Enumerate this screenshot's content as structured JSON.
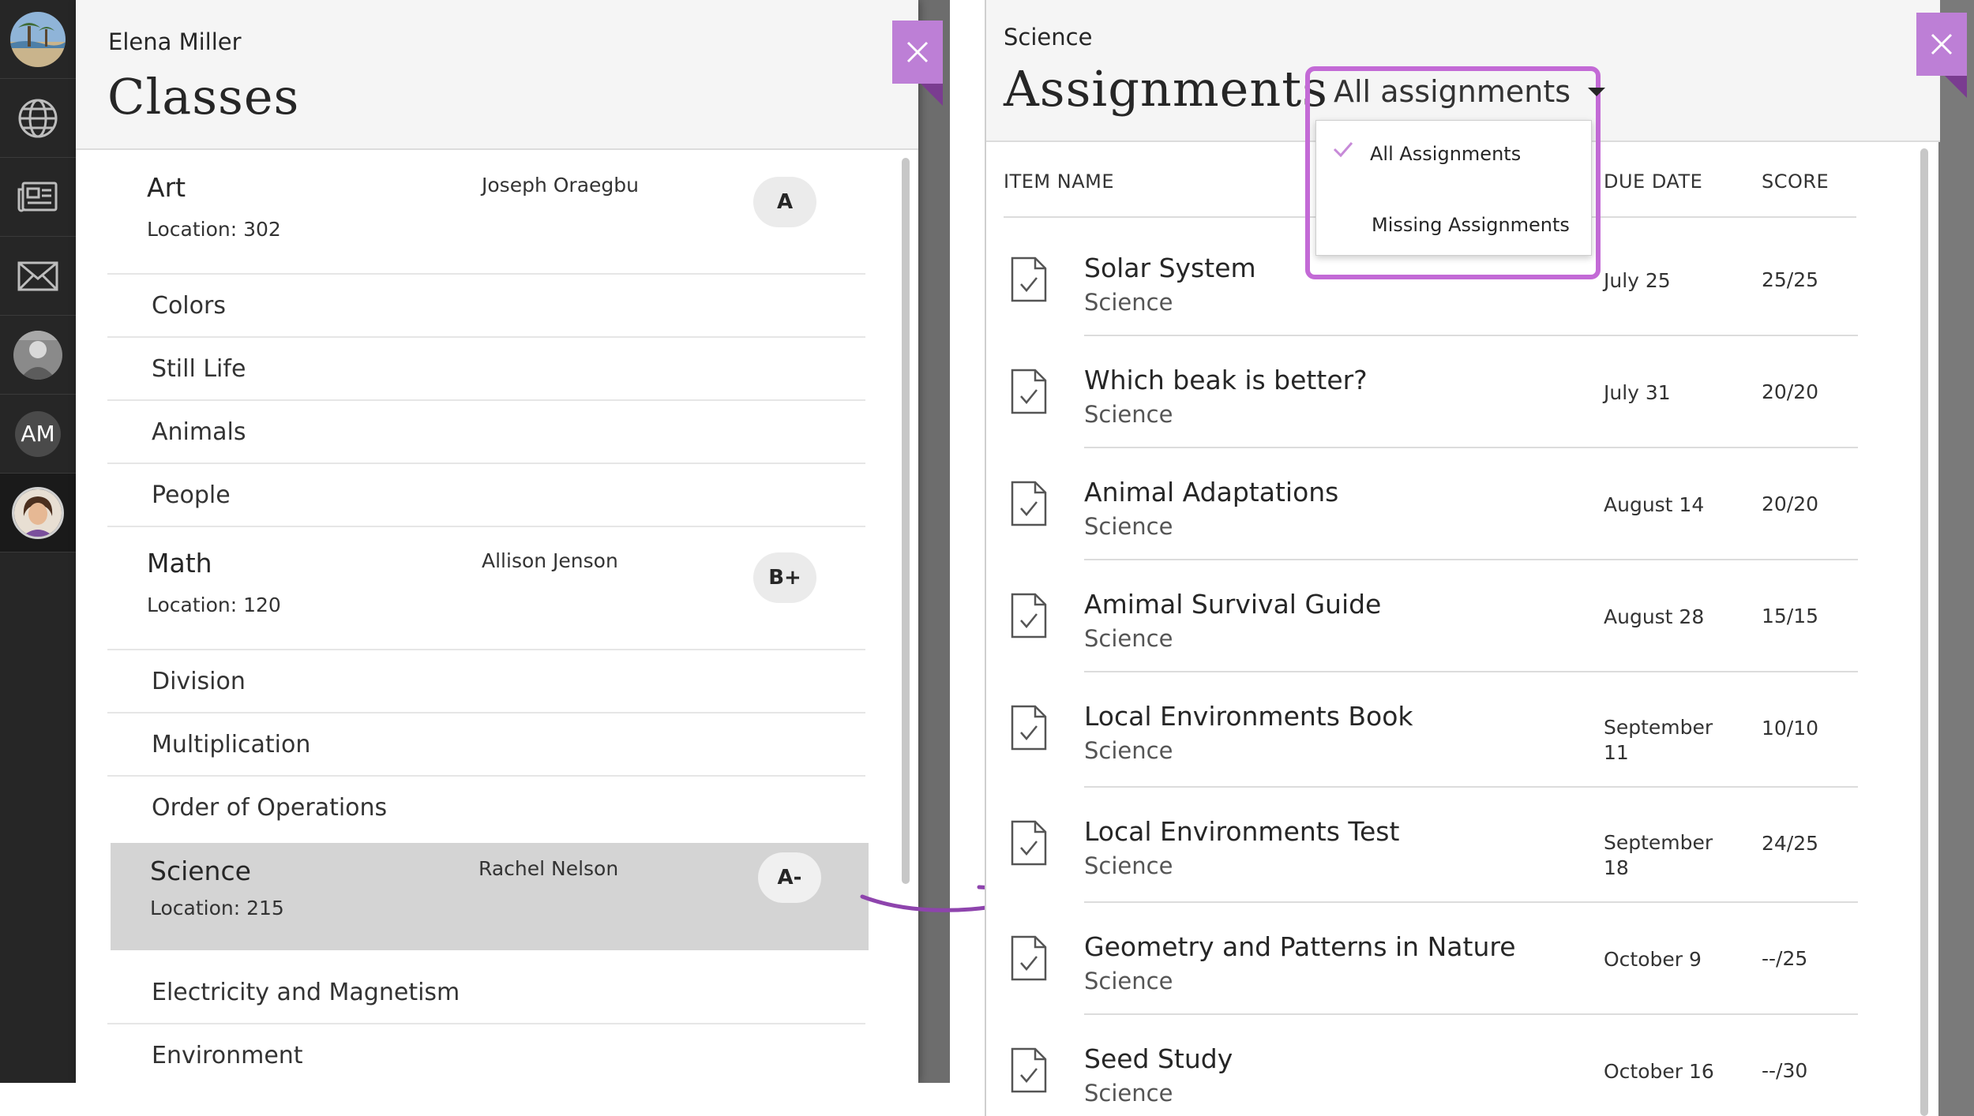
{
  "colors": {
    "accent": "#c36ad6",
    "close_button": "#bd7fd6",
    "nav_background": "#262626",
    "selected_row": "#d4d4d4"
  },
  "sidebar": {
    "items": [
      {
        "name": "institution-logo",
        "icon": "beach-photo-icon"
      },
      {
        "name": "globe",
        "icon": "globe-icon"
      },
      {
        "name": "activity-stream",
        "icon": "newspaper-icon"
      },
      {
        "name": "messages",
        "icon": "envelope-icon"
      },
      {
        "name": "profile-photo",
        "icon": "person-photo-icon"
      },
      {
        "name": "user-initials",
        "initials": "AM"
      },
      {
        "name": "current-user",
        "icon": "user-avatar-icon"
      }
    ]
  },
  "classes_panel": {
    "user_name": "Elena Miller",
    "title": "Classes",
    "classes": [
      {
        "name": "Art",
        "teacher": "Joseph Oraegbu",
        "location": "Location: 302",
        "grade": "A",
        "topics": [
          "Colors",
          "Still Life",
          "Animals",
          "People"
        ]
      },
      {
        "name": "Math",
        "teacher": "Allison Jenson",
        "location": "Location: 120",
        "grade": "B+",
        "topics": [
          "Division",
          "Multiplication",
          "Order of Operations"
        ]
      },
      {
        "name": "Science",
        "teacher": "Rachel Nelson",
        "location": "Location: 215",
        "grade": "A-",
        "topics": [
          "Electricity and Magnetism",
          "Environment"
        ]
      }
    ]
  },
  "assignments_panel": {
    "course": "Science",
    "title": "Assignments",
    "filter": {
      "selected": "All assignments",
      "options": [
        "All Assignments",
        "Missing Assignments"
      ]
    },
    "columns": {
      "item_name": "ITEM NAME",
      "due_date": "DUE DATE",
      "score": "SCORE"
    },
    "rows": [
      {
        "title": "Solar System",
        "course": "Science",
        "due": "July 25",
        "score": "25/25"
      },
      {
        "title": "Which beak is better?",
        "course": "Science",
        "due": "July 31",
        "score": "20/20"
      },
      {
        "title": "Animal Adaptations",
        "course": "Science",
        "due": "August 14",
        "score": "20/20"
      },
      {
        "title": "Amimal Survival Guide",
        "course": "Science",
        "due": "August 28",
        "score": "15/15"
      },
      {
        "title": "Local Environments Book",
        "course": "Science",
        "due": "September 11",
        "score": "10/10"
      },
      {
        "title": "Local Environments Test",
        "course": "Science",
        "due": "September 18",
        "score": "24/25"
      },
      {
        "title": "Geometry and Patterns in Nature",
        "course": "Science",
        "due": "October 9",
        "score": "--/25"
      },
      {
        "title": "Seed Study",
        "course": "Science",
        "due": "October 16",
        "score": "--/30"
      }
    ]
  }
}
